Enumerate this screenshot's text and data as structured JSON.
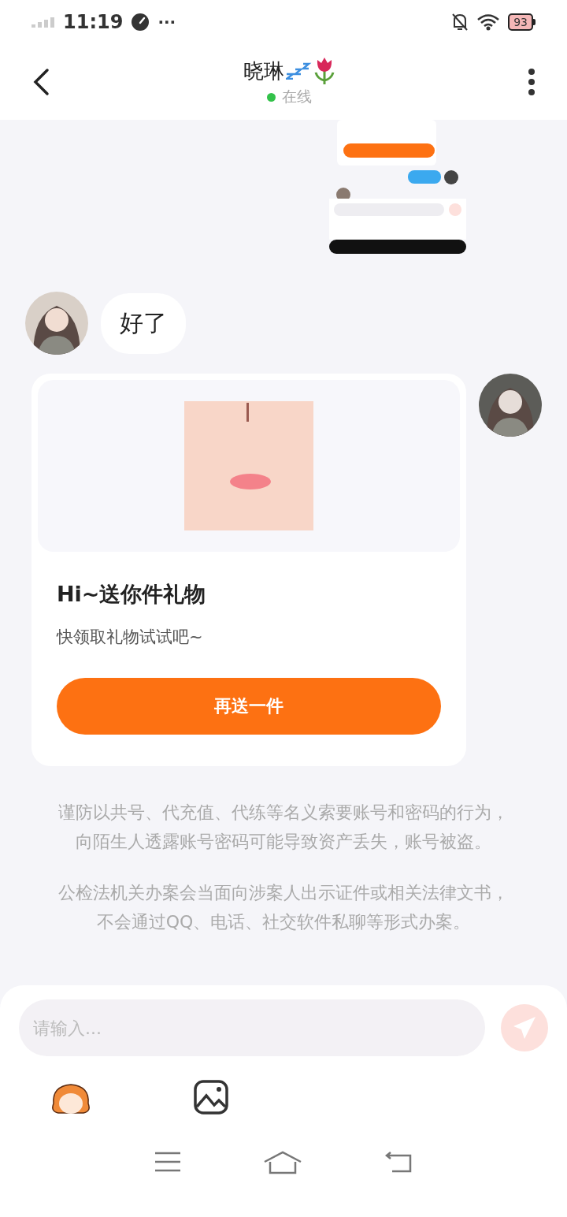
{
  "status_bar": {
    "time": "11:19",
    "more": "···",
    "battery": "93"
  },
  "header": {
    "title": "晓琳",
    "presence": {
      "label": "在线",
      "online": true
    }
  },
  "messages": [
    {
      "kind": "picture"
    },
    {
      "kind": "text",
      "text": "好了"
    },
    {
      "kind": "gift",
      "title": "Hi~送你件礼物",
      "subtitle": "快领取礼物试试吧~",
      "button": "再送一件"
    }
  ],
  "notices": [
    "谨防以共号、代充值、代练等名义索要账号和密码的行为，向陌生人透露账号密码可能导致资产丢失，账号被盗。",
    "公检法机关办案会当面向涉案人出示证件或相关法律文书，不会通过QQ、电话、社交软件私聊等形式办案。"
  ],
  "composer": {
    "placeholder": "请输入..."
  }
}
